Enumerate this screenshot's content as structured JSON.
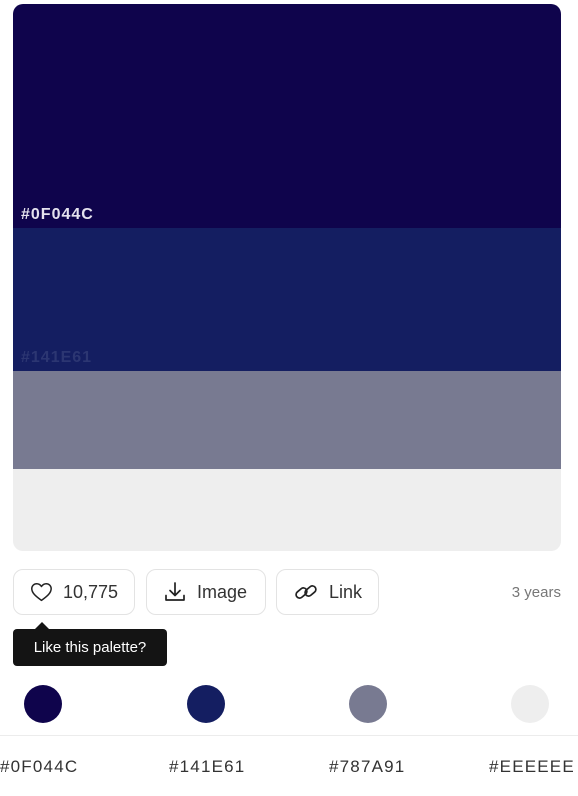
{
  "palette": {
    "swatches": [
      {
        "hex": "#0F044C",
        "label": "#0F044C",
        "label_color": "#e4e2ee"
      },
      {
        "hex": "#141E61",
        "label": "#141E61",
        "label_color": "#2c3672"
      },
      {
        "hex": "#787A91",
        "label": "",
        "label_color": "#ffffff"
      },
      {
        "hex": "#EEEEEE",
        "label": "",
        "label_color": "#333333"
      }
    ]
  },
  "actions": {
    "like_count": "10,775",
    "image_label": "Image",
    "link_label": "Link",
    "age": "3 years"
  },
  "tooltip": {
    "text": "Like this palette?"
  },
  "colors": [
    {
      "hex": "#0F044C",
      "code": "#0F044C"
    },
    {
      "hex": "#141E61",
      "code": "#141E61"
    },
    {
      "hex": "#787A91",
      "code": "#787A91"
    },
    {
      "hex": "#EEEEEE",
      "code": "#EEEEEE"
    }
  ],
  "icons": {
    "like": "heart-icon",
    "image": "download-icon",
    "link": "link-icon"
  }
}
